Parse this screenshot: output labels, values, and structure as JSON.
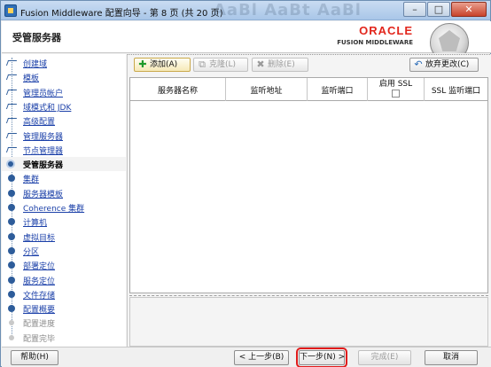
{
  "window": {
    "title": "Fusion Middleware 配置向导 - 第 8 页 (共 20 页)",
    "title_background_text": "AaBl  AaBt  AaBl"
  },
  "header": {
    "page_title": "受管服务器",
    "logo_name": "ORACLE",
    "logo_sub": "FUSION MIDDLEWARE"
  },
  "nav": {
    "items": [
      {
        "label": "创建域",
        "state": "done"
      },
      {
        "label": "模板",
        "state": "done"
      },
      {
        "label": "管理员帐户",
        "state": "done"
      },
      {
        "label": "域模式和 JDK",
        "state": "done"
      },
      {
        "label": "高级配置",
        "state": "done"
      },
      {
        "label": "管理服务器",
        "state": "done"
      },
      {
        "label": "节点管理器",
        "state": "done"
      },
      {
        "label": "受管服务器",
        "state": "current"
      },
      {
        "label": "集群",
        "state": "todo"
      },
      {
        "label": "服务器模板",
        "state": "todo"
      },
      {
        "label": "Coherence 集群",
        "state": "todo"
      },
      {
        "label": "计算机",
        "state": "todo"
      },
      {
        "label": "虚拟目标",
        "state": "todo"
      },
      {
        "label": "分区",
        "state": "todo"
      },
      {
        "label": "部署定位",
        "state": "todo"
      },
      {
        "label": "服务定位",
        "state": "todo"
      },
      {
        "label": "文件存储",
        "state": "todo"
      },
      {
        "label": "配置概要",
        "state": "todo"
      },
      {
        "label": "配置进度",
        "state": "disabled"
      },
      {
        "label": "配置完毕",
        "state": "disabled"
      }
    ]
  },
  "toolbar": {
    "add": "添加(A)",
    "clone": "克隆(L)",
    "delete": "删除(E)",
    "discard": "放弃更改(C)"
  },
  "table": {
    "columns": [
      "服务器名称",
      "监听地址",
      "监听端口",
      "启用 SSL",
      "SSL 监听端口"
    ],
    "rows": []
  },
  "footer": {
    "help": "帮助(H)",
    "back": "< 上一步(B)",
    "next": "下一步(N) >",
    "finish": "完成(E)",
    "cancel": "取消"
  },
  "colors": {
    "accent": "#2d5c9a",
    "oracle_red": "#e2261c",
    "highlight": "#e01b1b"
  }
}
